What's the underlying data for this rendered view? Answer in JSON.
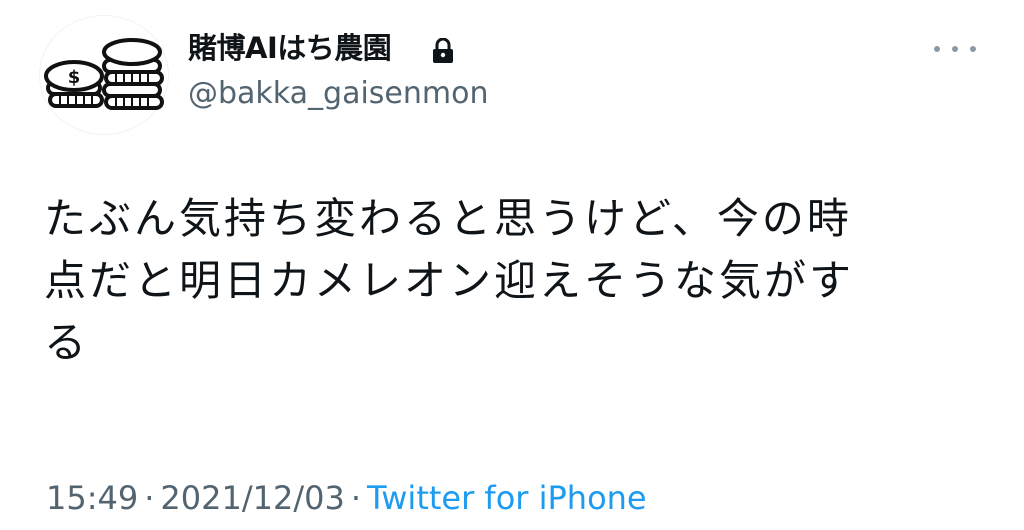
{
  "author": {
    "display_name": "賭博AIはち農園",
    "handle": "@bakka_gaisenmon",
    "avatar_icon": "coin-stacks-icon",
    "protected_icon": "lock-icon"
  },
  "tweet": {
    "lines": [
      "たぶん気持ち変わると思うけど、今の時",
      "点だと明日カメレオン迎えそうな気がす",
      "る"
    ]
  },
  "meta": {
    "time": "15:49",
    "separator": "·",
    "date": "2021/12/03",
    "source": "Twitter for iPhone"
  },
  "colors": {
    "text": "#0f1419",
    "secondary": "#536471",
    "link": "#1d9bf0"
  }
}
